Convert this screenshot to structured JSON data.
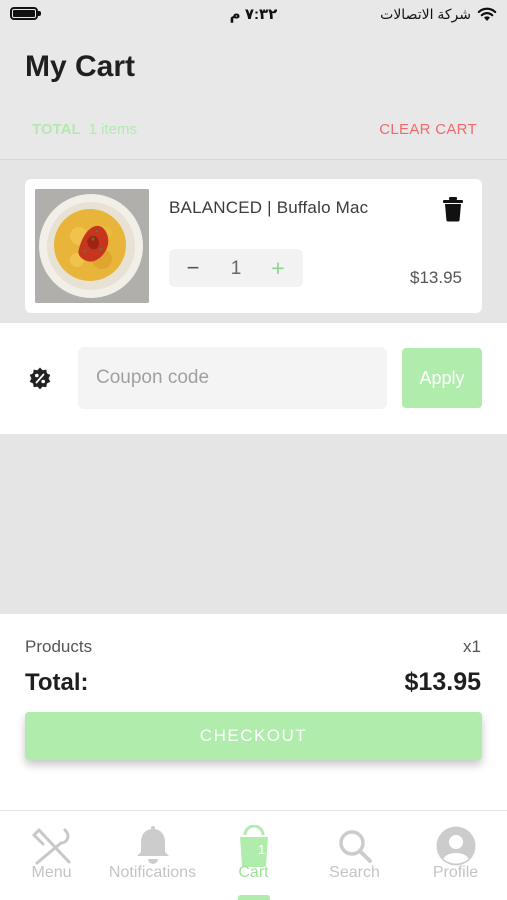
{
  "status_bar": {
    "time": "٧:٣٢ م",
    "carrier": "شركة الاتصالات"
  },
  "header": {
    "title": "My Cart",
    "total_label": "TOTAL",
    "items_count": "1 items",
    "clear_cart": "CLEAR CART"
  },
  "cart": {
    "items": [
      {
        "name": "BALANCED | Buffalo Mac",
        "quantity": "1",
        "price": "$13.95",
        "minus": "−",
        "plus": "+"
      }
    ]
  },
  "coupon": {
    "placeholder": "Coupon code",
    "value": "",
    "apply_label": "Apply"
  },
  "summary": {
    "products_label": "Products",
    "products_qty": "x1",
    "total_label": "Total:",
    "total_value": "$13.95",
    "checkout_label": "CHECKOUT"
  },
  "tabs": [
    {
      "label": "Menu",
      "icon": "utensils-icon",
      "active": false
    },
    {
      "label": "Notifications",
      "icon": "bell-icon",
      "active": false
    },
    {
      "label": "Cart",
      "icon": "shopping-bag-icon",
      "active": true,
      "badge": "1"
    },
    {
      "label": "Search",
      "icon": "search-icon",
      "active": false
    },
    {
      "label": "Profile",
      "icon": "user-icon",
      "active": false
    }
  ],
  "colors": {
    "accent_green": "#b0ecac",
    "danger_red": "#f06b6b",
    "background_gray": "#e5e5e5"
  }
}
